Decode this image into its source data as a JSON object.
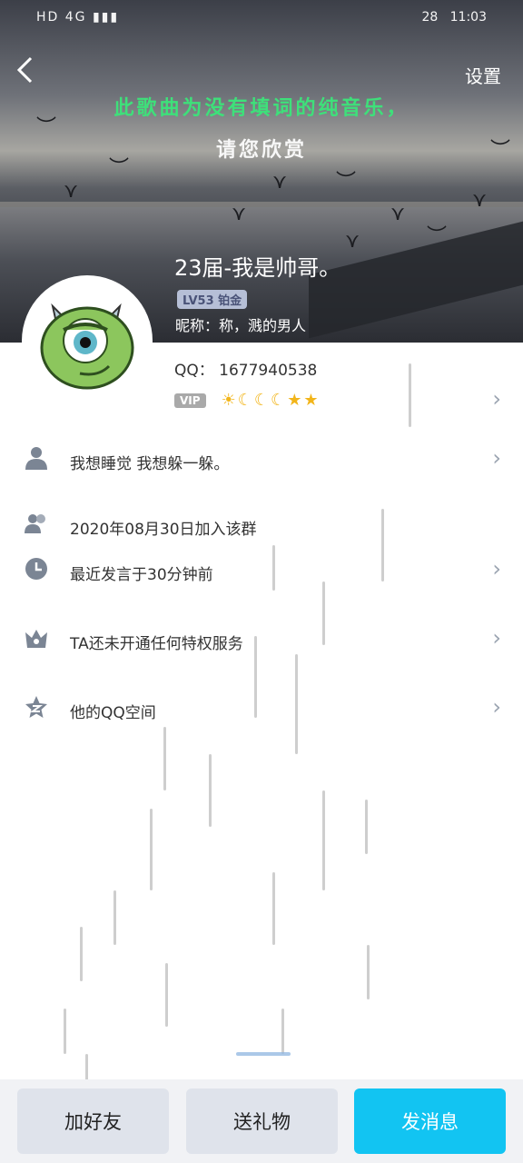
{
  "status_bar": {
    "left": "HD 4G ▮▮▮",
    "right_battery": "28",
    "time": "11:03"
  },
  "header": {
    "back_icon": "chevron-left-icon",
    "settings_label": "设置",
    "lyric_line1": "此歌曲为没有填词的纯音乐，",
    "lyric_line2": "请您欣赏"
  },
  "profile": {
    "nickname": "23届-我是帅哥。",
    "level_badge": "LV53 铂金",
    "alias_label": "昵称：",
    "alias_value": "称，溅的男人",
    "qq_label": "QQ：",
    "qq_number": "1677940538",
    "vip_label": "VIP",
    "vip_icons": "☀☾☾☾★★"
  },
  "rows": [
    {
      "icon": "person-icon",
      "text": "我想睡觉 我想躲一躲。"
    },
    {
      "icon": "group-icon",
      "text": "2020年08月30日加入该群"
    },
    {
      "icon": "clock-icon",
      "text": "最近发言于30分钟前"
    },
    {
      "icon": "crown-icon",
      "text": "TA还未开通任何特权服务"
    },
    {
      "icon": "qzone-star-icon",
      "text": "他的QQ空间"
    }
  ],
  "footer": {
    "add_friend": "加好友",
    "send_gift": "送礼物",
    "send_message": "发消息"
  },
  "colors": {
    "accent": "#12c4f2",
    "lyric_green": "#3ee07a",
    "badge_bg": "#b6bfd6"
  }
}
